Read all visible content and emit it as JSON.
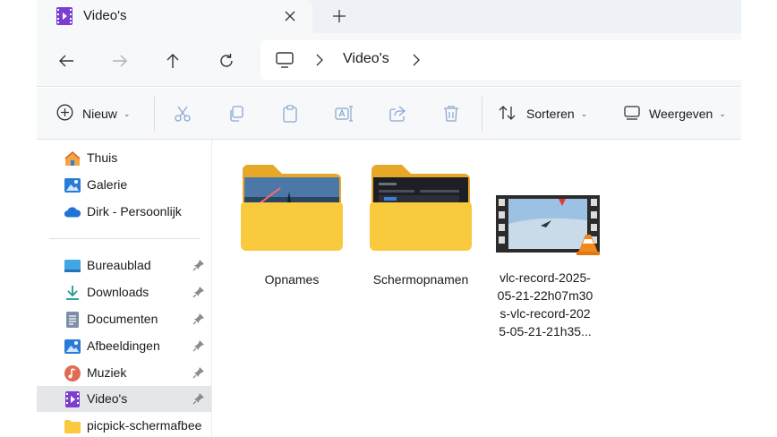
{
  "tab": {
    "title": "Video's"
  },
  "address": {
    "crumb": "Video's"
  },
  "toolbar": {
    "new_label": "Nieuw",
    "sort_label": "Sorteren",
    "view_label": "Weergeven"
  },
  "sidebar": {
    "top_items": [
      {
        "label": "Thuis",
        "icon": "home-icon"
      },
      {
        "label": "Galerie",
        "icon": "gallery-icon"
      },
      {
        "label": "Dirk - Persoonlijk",
        "icon": "onedrive-cloud-icon"
      }
    ],
    "pinned_items": [
      {
        "label": "Bureaublad",
        "icon": "desktop-icon"
      },
      {
        "label": "Downloads",
        "icon": "download-icon"
      },
      {
        "label": "Documenten",
        "icon": "documents-icon"
      },
      {
        "label": "Afbeeldingen",
        "icon": "pictures-icon"
      },
      {
        "label": "Muziek",
        "icon": "music-icon"
      },
      {
        "label": "Video's",
        "icon": "videos-icon",
        "selected": true
      },
      {
        "label": "picpick-schermafbee",
        "icon": "folder-icon"
      }
    ]
  },
  "files": [
    {
      "name": "Opnames",
      "type": "folder"
    },
    {
      "name": "Schermopnamen",
      "type": "folder"
    },
    {
      "name": "vlc-record-2025-05-21-22h07m30s-vlc-record-2025-05-21-21h35...",
      "type": "video",
      "name_lines": [
        "vlc-record-2025-",
        "05-21-22h07m30",
        "s-vlc-record-202",
        "5-05-21-21h35..."
      ]
    }
  ],
  "colors": {
    "folder_yellow": "#f9c93e",
    "folder_back": "#e7a829",
    "video_purple": "#7a3fd0",
    "accent_blue": "#2a7bd8",
    "selected_bg": "#e4e6ea"
  }
}
